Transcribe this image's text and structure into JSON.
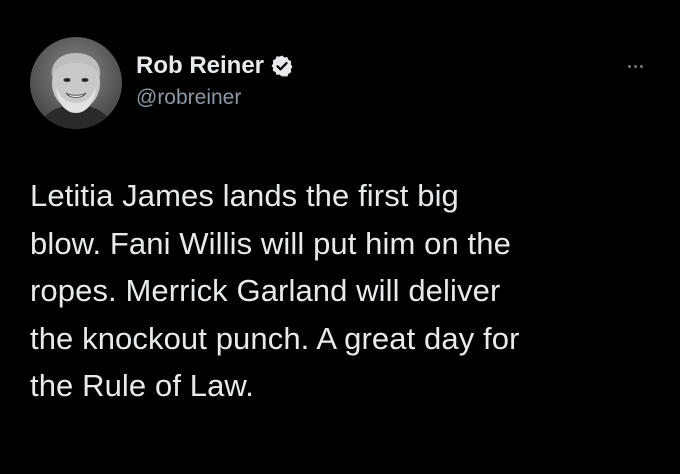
{
  "author": {
    "display_name": "Rob Reiner",
    "handle": "@robreiner",
    "verified": true
  },
  "icons": {
    "verified": "verified-badge-icon",
    "more": "more-dots-icon",
    "avatar": "avatar-photo"
  },
  "tweet": {
    "text_lines": [
      "Letitia James lands the first big",
      "blow. Fani Willis will put him on the",
      "ropes. Merrick Garland will deliver",
      "the knockout punch. A great day for",
      "the Rule of Law."
    ]
  },
  "colors": {
    "background": "#000000",
    "text": "#e7e9ea",
    "secondary_text": "#8b98a5"
  }
}
